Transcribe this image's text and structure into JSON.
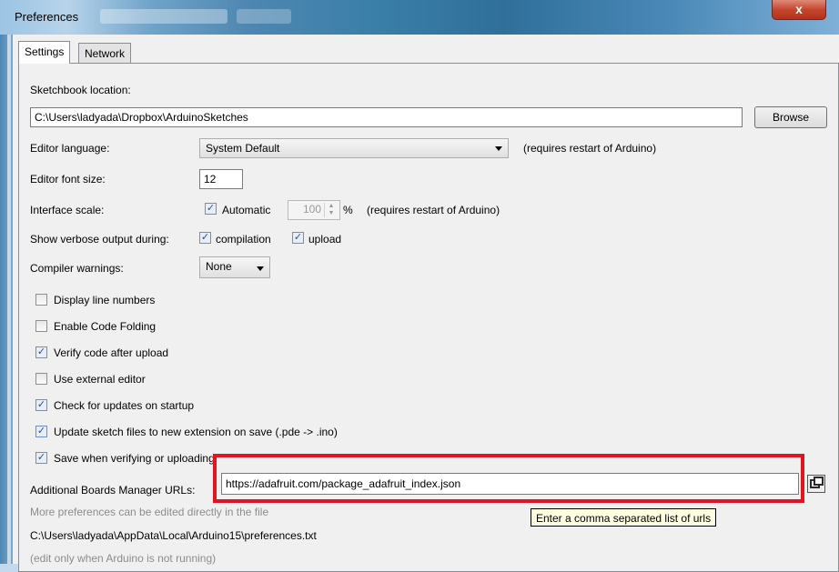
{
  "window": {
    "title": "Preferences",
    "close_label": "x"
  },
  "tabs": [
    {
      "label": "Settings"
    },
    {
      "label": "Network"
    }
  ],
  "sketchbook": {
    "label": "Sketchbook location:",
    "value": "C:\\Users\\ladyada\\Dropbox\\ArduinoSketches",
    "browse_label": "Browse"
  },
  "editor_language": {
    "label": "Editor language:",
    "value": "System Default",
    "note": "(requires restart of Arduino)"
  },
  "editor_font_size": {
    "label": "Editor font size:",
    "value": "12"
  },
  "interface_scale": {
    "label": "Interface scale:",
    "automatic_label": "Automatic",
    "automatic_checked": true,
    "value": "100",
    "unit": "%",
    "note": "(requires restart of Arduino)"
  },
  "verbose": {
    "label": "Show verbose output during:",
    "compilation_label": "compilation",
    "compilation_checked": true,
    "upload_label": "upload",
    "upload_checked": true
  },
  "compiler_warnings": {
    "label": "Compiler warnings:",
    "value": "None"
  },
  "options": [
    {
      "label": "Display line numbers",
      "checked": false
    },
    {
      "label": "Enable Code Folding",
      "checked": false
    },
    {
      "label": "Verify code after upload",
      "checked": true
    },
    {
      "label": "Use external editor",
      "checked": false
    },
    {
      "label": "Check for updates on startup",
      "checked": true
    },
    {
      "label": "Update sketch files to new extension on save (.pde -> .ino)",
      "checked": true
    },
    {
      "label": "Save when verifying or uploading",
      "checked": true
    }
  ],
  "boards_manager": {
    "label": "Additional Boards Manager URLs:",
    "value": "https://adafruit.com/package_adafruit_index.json",
    "tooltip": "Enter a comma separated list of urls"
  },
  "footer": {
    "more_prefs": "More preferences can be edited directly in the file",
    "prefs_path": "C:\\Users\\ladyada\\AppData\\Local\\Arduino15\\preferences.txt",
    "edit_note": "(edit only when Arduino is not running)"
  },
  "colors": {
    "highlight_box": "#e3141f",
    "tooltip_bg": "#ffffe1"
  }
}
